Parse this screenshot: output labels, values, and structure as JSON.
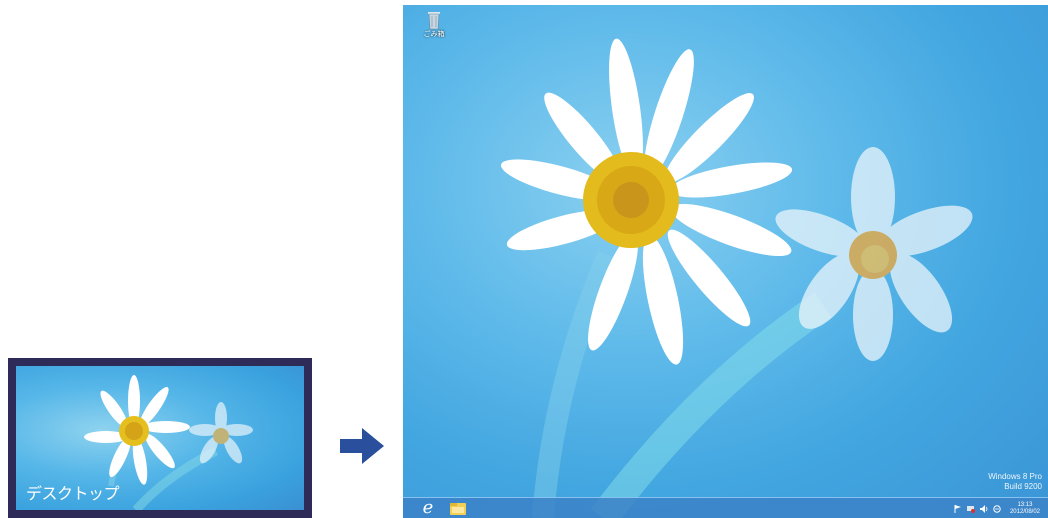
{
  "start_tile": {
    "label": "デスクトップ"
  },
  "desktop": {
    "recycle_bin_label": "ごみ箱",
    "watermark": {
      "line1": "Windows 8 Pro",
      "line2": "Build 9200"
    },
    "taskbar": {
      "clock_time": "13:13",
      "clock_date": "2012/08/02",
      "ie_icon": "internet-explorer-icon",
      "explorer_icon": "file-explorer-icon"
    }
  },
  "colors": {
    "tile_frame": "#2e2b59",
    "sky_blue": "#4aa8e0",
    "arrow_blue": "#2a4f9c",
    "petal": "#ffffff",
    "flower_center": "#e9c421"
  }
}
